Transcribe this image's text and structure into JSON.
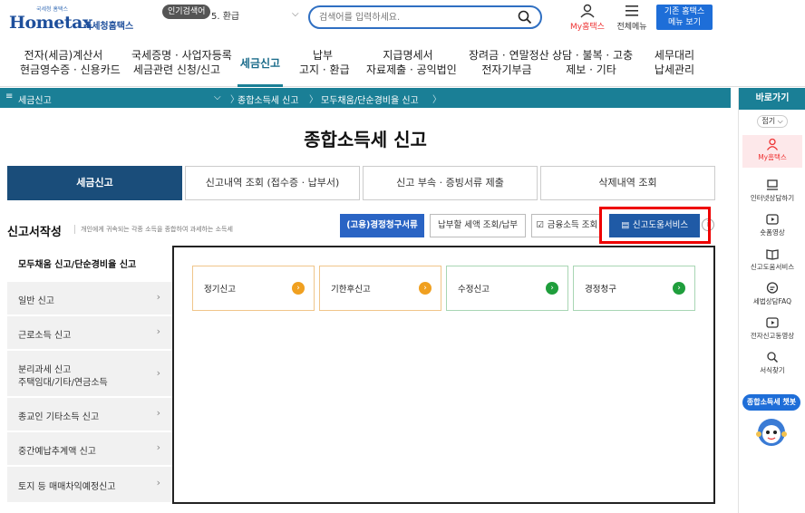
{
  "header": {
    "logo_small": "국세청 홈택스",
    "logo_brand": "Hometax",
    "logo_korean": "국세청홈택스",
    "popular_badge": "인기검색어",
    "popular_rank": "5.  환급",
    "search_placeholder": "검색어를 입력하세요.",
    "my_hometax": "My홈택스",
    "full_menu": "전체메뉴",
    "old_hometax_line1": "기존 홈택스",
    "old_hometax_line2": "메뉴 보기"
  },
  "gnb": [
    {
      "l1": "전자(세금)계산서",
      "l2": "현금영수증 · 신용카드"
    },
    {
      "l1": "국세증명 · 사업자등록",
      "l2": "세금관련 신청/신고"
    },
    {
      "l1": "세금신고",
      "l2": ""
    },
    {
      "l1": "납부",
      "l2": "고지 · 환급"
    },
    {
      "l1": "지급명세서",
      "l2": "자료제출 · 공익법인"
    },
    {
      "l1": "장려금 · 연말정산",
      "l2": "전자기부금"
    },
    {
      "l1": "상담 · 불복 · 고충",
      "l2": "제보 · 기타"
    },
    {
      "l1": "세무대리",
      "l2": "납세관리"
    }
  ],
  "breadcrumb": {
    "menu_icon": "≡",
    "level1": "세금신고",
    "level2": "종합소득세 신고",
    "level3": "모두채움/단순경비율 신고"
  },
  "page_title": "종합소득세 신고",
  "tabs": [
    "세금신고",
    "신고내역 조회 (접수증 · 납부서)",
    "신고 부속 · 증빙서류 제출",
    "삭제내역 조회"
  ],
  "section": {
    "title": "신고서작성",
    "desc": "개인에게 귀속되는 각종 소득을 종합하여 과세하는 소득세"
  },
  "buttons": {
    "correction": "(고용)경정청구서류",
    "tax_due": "납부할 세액 조회/납부",
    "financial": "금융소득 조회",
    "help_service": "신고도움서비스"
  },
  "side_menu": [
    {
      "label": "모두채움 신고/단순경비율 신고",
      "label2": ""
    },
    {
      "label": "일반 신고",
      "label2": ""
    },
    {
      "label": "근로소득 신고",
      "label2": ""
    },
    {
      "label": "분리과세 신고",
      "label2": "주택임대/기타/연금소득"
    },
    {
      "label": "종교인 기타소득 신고",
      "label2": ""
    },
    {
      "label": "중간예납추계액 신고",
      "label2": ""
    },
    {
      "label": "토지 등 매매차익예정신고",
      "label2": ""
    }
  ],
  "cards": [
    {
      "label": "정기신고",
      "color": "#f0a020"
    },
    {
      "label": "기한후신고",
      "color": "#f0a020"
    },
    {
      "label": "수정신고",
      "color": "#1f9e3c"
    },
    {
      "label": "경정청구",
      "color": "#1f9e3c"
    }
  ],
  "quick": {
    "header": "바로가기",
    "fold": "접기",
    "items": [
      "My홈택스",
      "인터넷상담하기",
      "숏폼영상",
      "신고도움서비스",
      "세법상담FAQ",
      "전자신고동영상",
      "서식찾기"
    ],
    "chatbot": "종합소득세 챗봇"
  }
}
